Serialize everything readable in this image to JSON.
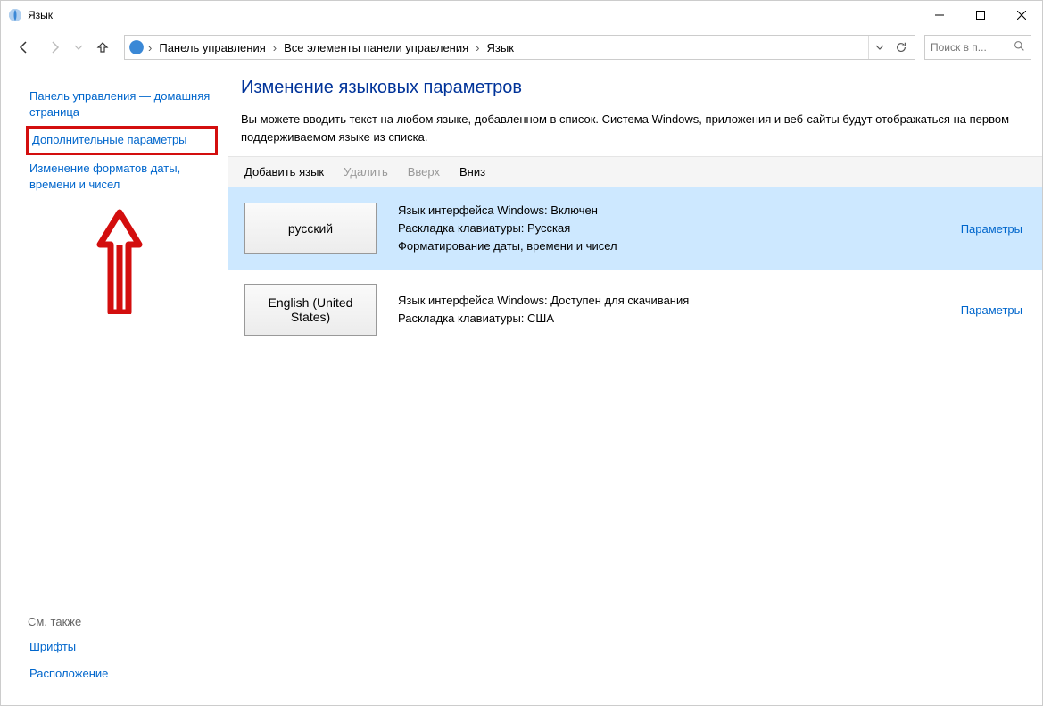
{
  "window": {
    "title": "Язык"
  },
  "breadcrumb": {
    "items": [
      "Панель управления",
      "Все элементы панели управления",
      "Язык"
    ]
  },
  "search": {
    "placeholder": "Поиск в п..."
  },
  "sidebar": {
    "home": "Панель управления — домашняя страница",
    "advanced": "Дополнительные параметры",
    "formats": "Изменение форматов даты, времени и чисел",
    "see_also_heading": "См. также",
    "fonts": "Шрифты",
    "location": "Расположение"
  },
  "page": {
    "title": "Изменение языковых параметров",
    "description": "Вы можете вводить текст на любом языке, добавленном в список. Система Windows, приложения и веб-сайты будут отображаться на первом поддерживаемом языке из списка."
  },
  "toolbar": {
    "add": "Добавить язык",
    "remove": "Удалить",
    "up": "Вверх",
    "down": "Вниз"
  },
  "languages": [
    {
      "name": "русский",
      "lines": [
        "Язык интерфейса Windows: Включен",
        "Раскладка клавиатуры: Русская",
        "Форматирование даты, времени и чисел"
      ],
      "options_label": "Параметры",
      "selected": true
    },
    {
      "name": "English (United States)",
      "lines": [
        "Язык интерфейса Windows: Доступен для скачивания",
        "Раскладка клавиатуры: США"
      ],
      "options_label": "Параметры",
      "selected": false
    }
  ]
}
